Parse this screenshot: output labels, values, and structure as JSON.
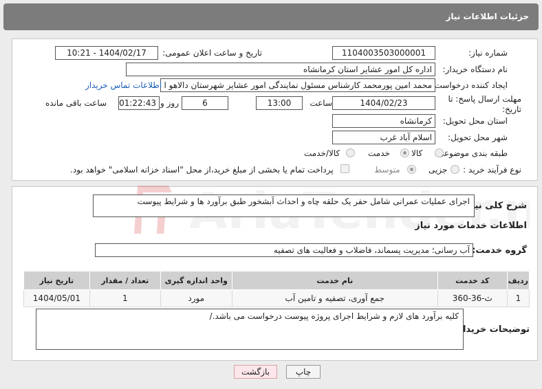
{
  "header": {
    "title": "جزئیات اطلاعات نیاز"
  },
  "form": {
    "need_number_label": "شماره نیاز:",
    "need_number": "1104003503000001",
    "announce_label": "تاریخ و ساعت اعلان عمومی:",
    "announce_value": "1404/02/17 - 10:21",
    "buyer_org_label": "نام دستگاه خریدار:",
    "buyer_org": "اداره کل امور عشایر استان کرمانشاه",
    "creator_label": "ایجاد کننده درخواست:",
    "creator": "محمد امین پورمحمد کارشناس مسئول نمایندگی امور عشایر شهرستان دالاهو ا",
    "contact_link": "اطلاعات تماس خریدار",
    "deadline_label": "مهلت ارسال پاسخ: تا تاریخ:",
    "deadline_date": "1404/02/23",
    "time_label": "ساعت",
    "deadline_time": "13:00",
    "days_value": "6",
    "days_label": "روز و",
    "remaining_time": "01:22:43",
    "remaining_label": "ساعت باقی مانده",
    "province_label": "استان محل تحویل:",
    "province": "کرمانشاه",
    "city_label": "شهر محل تحویل:",
    "city": "اسلام آباد غرب",
    "category_label": "طبقه بندی موضوعی:",
    "category_options": [
      "کالا",
      "خدمت",
      "کالا/خدمت"
    ],
    "category_selected": "خدمت",
    "process_label": "نوع فرآیند خرید :",
    "process_options": [
      "جزیی",
      "متوسط"
    ],
    "process_selected": "متوسط",
    "payment_note": "پرداخت تمام یا بخشی از مبلغ خرید،از محل \"اسناد خزانه اسلامی\" خواهد بود."
  },
  "summary": {
    "label": "شرح کلی نیاز:",
    "text": "اجرای عملیات عمرانی شامل حفر یک حلقه چاه و احداث آبشخور طبق برآورد ها و شرایط پیوست"
  },
  "services": {
    "section_title": "اطلاعات خدمات مورد نیاز",
    "group_label": "گروه خدمت:",
    "group_value": "آب رسانی؛ مدیریت پسماند، فاضلاب و فعالیت های تصفیه",
    "table": {
      "headers": [
        "ردیف",
        "کد خدمت",
        "نام خدمت",
        "واحد اندازه گیری",
        "تعداد / مقدار",
        "تاریخ نیاز"
      ],
      "rows": [
        [
          "1",
          "ث-36-360",
          "جمع آوری، تصفیه و تامین آب",
          "مورد",
          "1",
          "1404/05/01"
        ]
      ]
    }
  },
  "buyer_notes": {
    "label": "توضیحات خریدار:",
    "text": "کلیه برآورد های لازم و شرایط اجرای پروژه پیوست درخواست می باشد./"
  },
  "buttons": {
    "print": "چاپ",
    "back": "بازگشت"
  },
  "watermark": {
    "text": "AriaTender.neT"
  },
  "colors": {
    "header_bg": "#7c7c7c",
    "link": "#1a5fb4",
    "back_button_bg": "#fde7ea"
  }
}
